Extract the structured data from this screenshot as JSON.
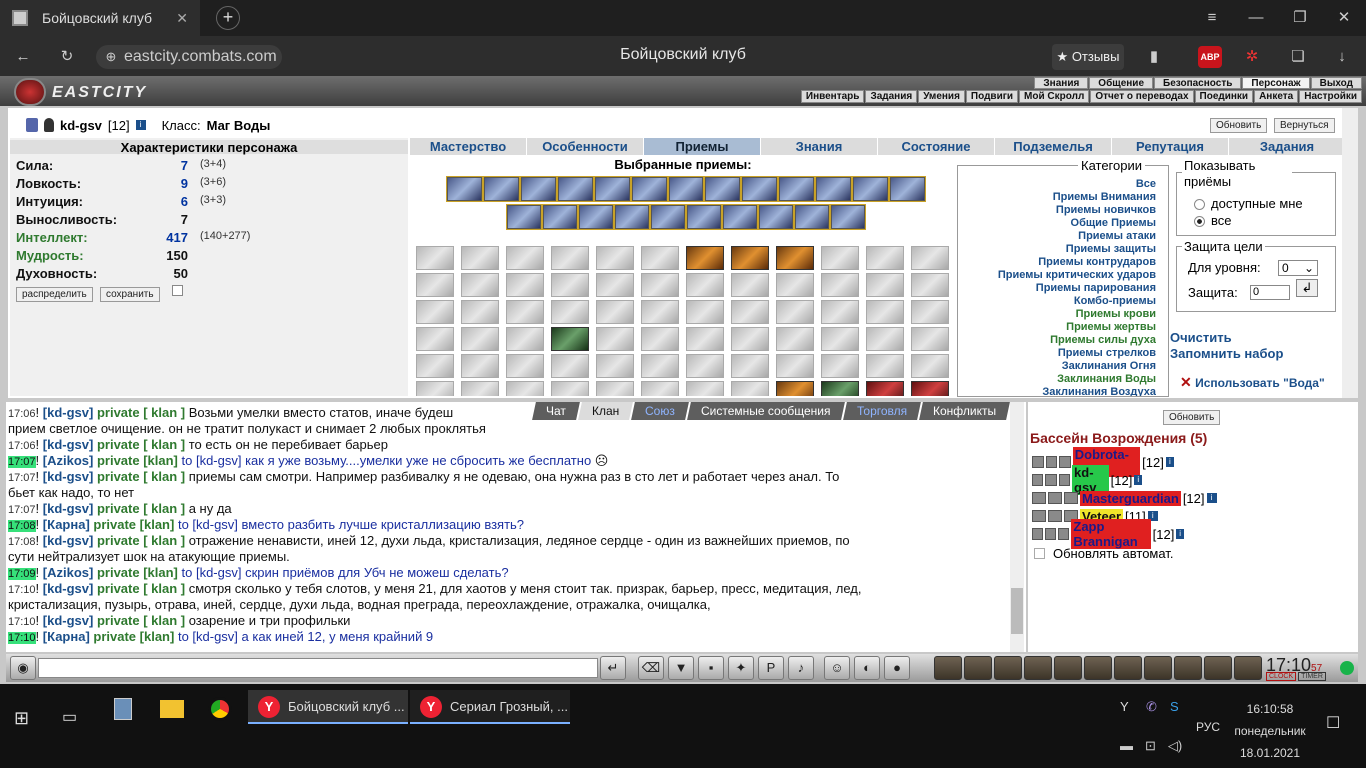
{
  "browser": {
    "tab_title": "Бойцовский клуб",
    "address": "eastcity.combats.com",
    "page_title": "Бойцовский клуб",
    "reviews": "★ Отзывы",
    "abp": "ABP"
  },
  "game": {
    "logo": "EASTCITY",
    "nav_top": [
      "Знания",
      "Общение",
      "Безопасность",
      "Персонаж",
      "Выход"
    ],
    "nav_sub": [
      "Инвентарь",
      "Задания",
      "Умения",
      "Подвиги",
      "Мой Скролл",
      "Отчет о переводах",
      "Поединки",
      "Анкета",
      "Настройки"
    ],
    "char": {
      "name": "kd-gsv",
      "level": "[12]",
      "class_label": "Класс:",
      "class": "Маг Воды",
      "refresh": "Обновить",
      "back": "Вернуться"
    },
    "stats_title": "Характеристики персонажа",
    "stats": [
      {
        "name": "Сила:",
        "value": "7",
        "extra": "(3+4)"
      },
      {
        "name": "Ловкость:",
        "value": "9",
        "extra": "(3+6)"
      },
      {
        "name": "Интуиция:",
        "value": "6",
        "extra": "(3+3)"
      },
      {
        "name": "Выносливость:",
        "value": "7",
        "extra": ""
      },
      {
        "name": "Интеллект:",
        "value": "417",
        "extra": "(140+277)"
      },
      {
        "name": "Мудрость:",
        "value": "150",
        "extra": ""
      },
      {
        "name": "Духовность:",
        "value": "50",
        "extra": ""
      }
    ],
    "distribute": "распределить",
    "save": "сохранить",
    "tabs": [
      "Мастерство",
      "Особенности",
      "Приемы",
      "Знания",
      "Состояние",
      "Подземелья",
      "Репутация",
      "Задания"
    ],
    "selected_title": "Выбранные приемы:",
    "categories_label": "Категории",
    "categories": [
      "Все",
      "Приемы Внимания",
      "Приемы новичков",
      "Общие Приемы",
      "Приемы атаки",
      "Приемы защиты",
      "Приемы контрударов",
      "Приемы критических ударов",
      "Приемы парирования",
      "Комбо-приемы",
      "Приемы крови",
      "Приемы жертвы",
      "Приемы силы духа",
      "Приемы стрелков",
      "Заклинания Огня",
      "Заклинания Воды",
      "Заклинания Воздуха"
    ],
    "show_label": "Показывать приёмы",
    "show_opts": [
      "доступные мне",
      "все"
    ],
    "protect_label": "Защита цели",
    "for_level": "Для уровня:",
    "level_val": "0",
    "protection": "Защита:",
    "prot_val": "0",
    "clear": "Очистить",
    "remember": "Запомнить набор",
    "use": "Использовать \"Вода\""
  },
  "chat": {
    "tabs": [
      "Чат",
      "Клан",
      "Союз",
      "Системные сообщения",
      "Торговля",
      "Конфликты"
    ],
    "lines": [
      {
        "t": "17:06",
        "h": false,
        "nick": "[kd-gsv]",
        "p": "private [ klan ]",
        "msg": "Возьми умелки вместо статов, иначе будеш",
        "c": "k"
      },
      {
        "t": "",
        "h": false,
        "nick": "",
        "p": "",
        "msg": "прием светлое очищение. он не тратит полукаст и снимает 2 любых проклятья",
        "c": "k"
      },
      {
        "t": "17:06",
        "h": false,
        "nick": "[kd-gsv]",
        "p": "private [ klan ]",
        "msg": "то есть он не перебивает барьер",
        "c": "k"
      },
      {
        "t": "17:07",
        "h": true,
        "nick": "[Azikos]",
        "p": "private [klan]",
        "msg": "to [kd-gsv] как я уже возьму....умелки уже не сбросить же бесплатно",
        "c": "b"
      },
      {
        "t": "17:07",
        "h": false,
        "nick": "[kd-gsv]",
        "p": "private [ klan ]",
        "msg": "приемы сам смотри. Например разбивалку я не одеваю, она нужна раз в сто лет и работает через анал. То",
        "c": "k"
      },
      {
        "t": "",
        "h": false,
        "nick": "",
        "p": "",
        "msg": "бьет как надо, то нет",
        "c": "k"
      },
      {
        "t": "17:07",
        "h": false,
        "nick": "[kd-gsv]",
        "p": "private [ klan ]",
        "msg": "а ну да",
        "c": "k"
      },
      {
        "t": "17:08",
        "h": true,
        "nick": "[Карна]",
        "p": "private [klan]",
        "msg": "to [kd-gsv] вместо разбить лучше кристаллизацию взять?",
        "c": "b"
      },
      {
        "t": "17:08",
        "h": false,
        "nick": "[kd-gsv]",
        "p": "private [ klan ]",
        "msg": "отражение ненависти, иней 12, духи льда, кристализация, ледяное сердце - один из важнейших приемов, по",
        "c": "k"
      },
      {
        "t": "",
        "h": false,
        "nick": "",
        "p": "",
        "msg": "сути нейтрализует шок на атакующие приемы.",
        "c": "k"
      },
      {
        "t": "17:09",
        "h": true,
        "nick": "[Azikos]",
        "p": "private [klan]",
        "msg": "to [kd-gsv] скрин приёмов для Убч не можеш сделать?",
        "c": "b"
      },
      {
        "t": "17:10",
        "h": false,
        "nick": "[kd-gsv]",
        "p": "private [ klan ]",
        "msg": "смотря сколько у тебя слотов, у меня 21, для хаотов у меня стоит так. призрак, барьер, пресс, медитация, лед,",
        "c": "k"
      },
      {
        "t": "",
        "h": false,
        "nick": "",
        "p": "",
        "msg": "кристализация, пузырь, отрава, иней, сердце, духи льда, водная преграда, переохлаждение, отражалка, очищалка,",
        "c": "k"
      },
      {
        "t": "17:10",
        "h": false,
        "nick": "[kd-gsv]",
        "p": "private [ klan ]",
        "msg": "озарение и три профильки",
        "c": "k"
      },
      {
        "t": "17:10",
        "h": true,
        "nick": "[Карна]",
        "p": "private [klan]",
        "msg": "to [kd-gsv] а как иней 12, у меня крайний 9",
        "c": "b"
      }
    ]
  },
  "online": {
    "refresh": "Обновить",
    "title": "Бассейн Возрождения (5)",
    "users": [
      {
        "name": "Dobrota-new",
        "level": "[12]",
        "bg": "#e02020"
      },
      {
        "name": "kd-gsv",
        "level": "[12]",
        "bg": "#27c84a"
      },
      {
        "name": "Masterguardian",
        "level": "[12]",
        "bg": "#e02020"
      },
      {
        "name": "Veteer",
        "level": "[11]",
        "bg": "#f0e62a"
      },
      {
        "name": "Zapp Brannigan",
        "level": "[12]",
        "bg": "#e02020"
      }
    ],
    "auto": "Обновлять автомат."
  },
  "clock": {
    "time": "17:10",
    "sec": "57",
    "clock": "CLOCK",
    "timer": "TIMER"
  },
  "taskbar": {
    "tasks": [
      "Бойцовский клуб ...",
      "Сериал Грозный, ..."
    ],
    "lang": "РУС",
    "time": "16:10:58",
    "day": "понедельник",
    "date": "18.01.2021"
  }
}
